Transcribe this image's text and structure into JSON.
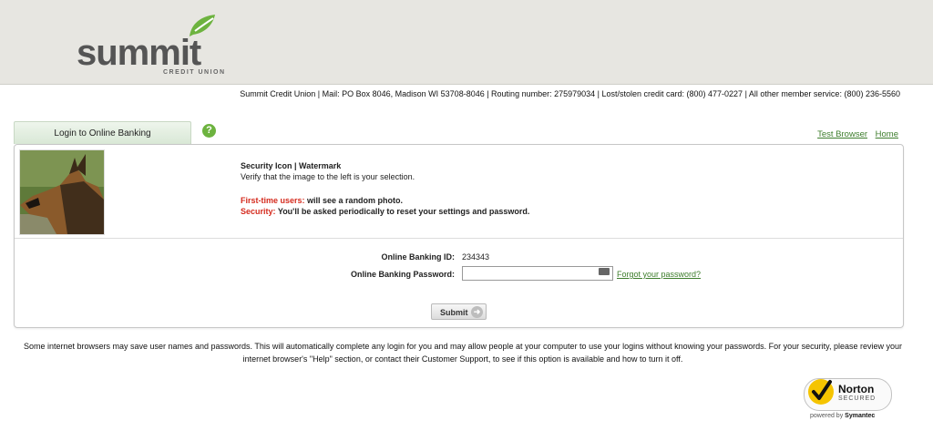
{
  "brand": {
    "name": "summit",
    "sub": "CREDIT UNION",
    "colors": {
      "green": "#6db33f",
      "gray": "#555555"
    }
  },
  "info_bar": "Summit Credit Union | Mail: PO Box 8046, Madison WI 53708-8046 | Routing number: 275979034 | Lost/stolen credit card: (800) 477-0227 | All other member service: (800) 236-5560",
  "tab": {
    "label": "Login to Online Banking"
  },
  "help_icon": "?",
  "links": {
    "test_browser": "Test Browser",
    "home": "Home"
  },
  "security": {
    "title": "Security Icon | Watermark",
    "verify": "Verify that the image to the left is your selection.",
    "first_label": "First-time users:",
    "first_text": " will see a random photo.",
    "security_label": "Security:",
    "security_text": " You'll be asked periodically to reset your settings and password."
  },
  "login": {
    "id_label": "Online Banking ID:",
    "id_value": "234343",
    "pw_label": "Online Banking Password:",
    "pw_value": "",
    "forgot": "Forgot your password?",
    "submit": "Submit"
  },
  "notice": "Some internet browsers may save user names and passwords. This will automatically complete any login for you and may allow people at your computer to use your logins without knowing your passwords. For your security, please review your internet browser's \"Help\" section, or contact their Customer Support, to see if this option is available and how to turn it off.",
  "norton": {
    "name": "Norton",
    "secured": "SECURED",
    "powered": "powered by",
    "vendor": "Symantec"
  }
}
